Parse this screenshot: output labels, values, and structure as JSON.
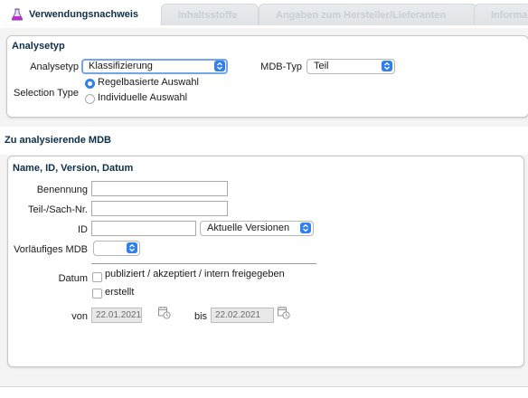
{
  "tabs": [
    {
      "label": "Verwendungsnachweis",
      "active": true,
      "icon": "flask-icon"
    },
    {
      "label": "Inhaltsstoffe",
      "active": false
    },
    {
      "label": "Angaben zum Hersteller/Lieferanten",
      "active": false
    },
    {
      "label": "Informa",
      "active": false
    }
  ],
  "analysetyp_panel": {
    "title": "Analysetyp",
    "analysetyp_label": "Analysetyp",
    "analysetyp_value": "Klassifizierung",
    "mdb_typ_label": "MDB-Typ",
    "mdb_typ_value": "Teil",
    "selection_type_label": "Selection Type",
    "options": [
      {
        "label": "Regelbasierte Auswahl",
        "selected": true
      },
      {
        "label": "Individuelle Auswahl",
        "selected": false
      }
    ]
  },
  "section_title": "Zu analysierende MDB",
  "search_panel": {
    "title": "Name, ID, Version, Datum",
    "benennung_label": "Benennung",
    "benennung_value": "",
    "teil_label": "Teil-/Sach-Nr.",
    "teil_value": "",
    "id_label": "ID",
    "id_value": "",
    "version_value": "Aktuelle Versionen",
    "vorlaeufig_label": "Vorläufiges MDB",
    "vorlaeufig_value": "",
    "datum_label": "Datum",
    "checkboxes": [
      {
        "label": "publiziert / akzeptiert / intern freigegeben",
        "checked": false
      },
      {
        "label": "erstellt",
        "checked": false
      }
    ],
    "von_label": "von",
    "von_value": "22.01.2021",
    "bis_label": "bis",
    "bis_value": "22.02.2021"
  },
  "colors": {
    "accent": "#2f7ff0",
    "title": "#0d2f4a",
    "focus_ring": "#72a6e8"
  }
}
